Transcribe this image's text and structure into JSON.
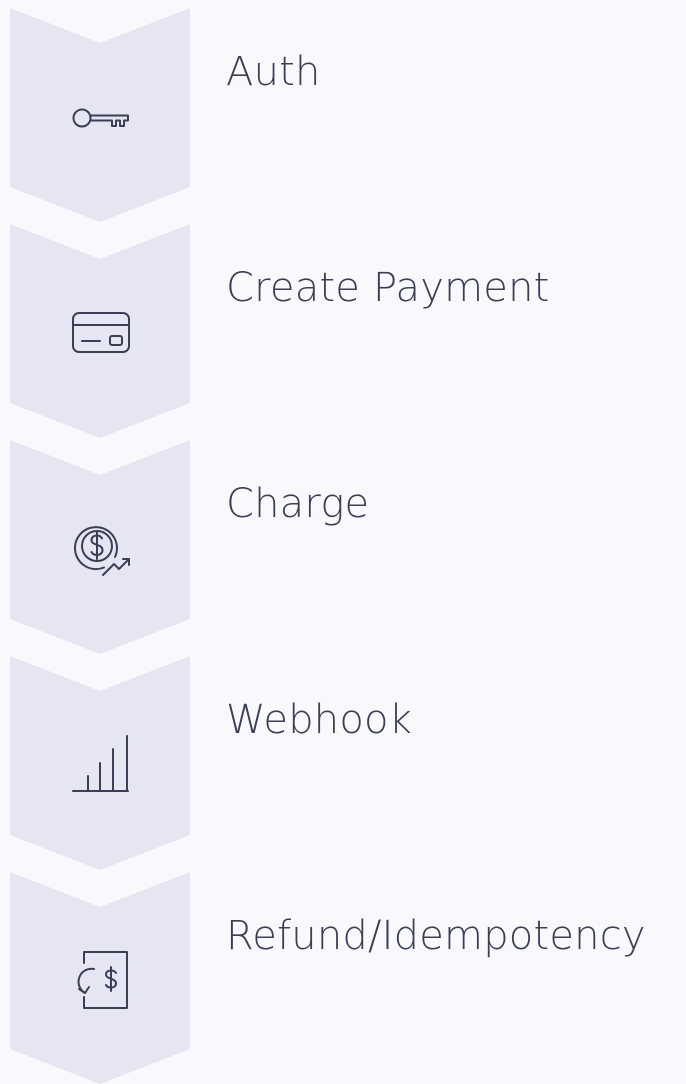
{
  "colors": {
    "background": "#f8f8fd",
    "chevron_fill": "#e5e6f1",
    "label_text": "#3b3f55",
    "icon_stroke": "#3b3f55"
  },
  "steps": [
    {
      "label": "Auth",
      "icon": "key-icon"
    },
    {
      "label": "Create Payment",
      "icon": "credit-card-icon"
    },
    {
      "label": "Charge",
      "icon": "dollar-coin-growth-icon"
    },
    {
      "label": "Webhook",
      "icon": "signal-bars-icon"
    },
    {
      "label": "Refund/Idempotency",
      "icon": "refund-document-icon"
    }
  ]
}
